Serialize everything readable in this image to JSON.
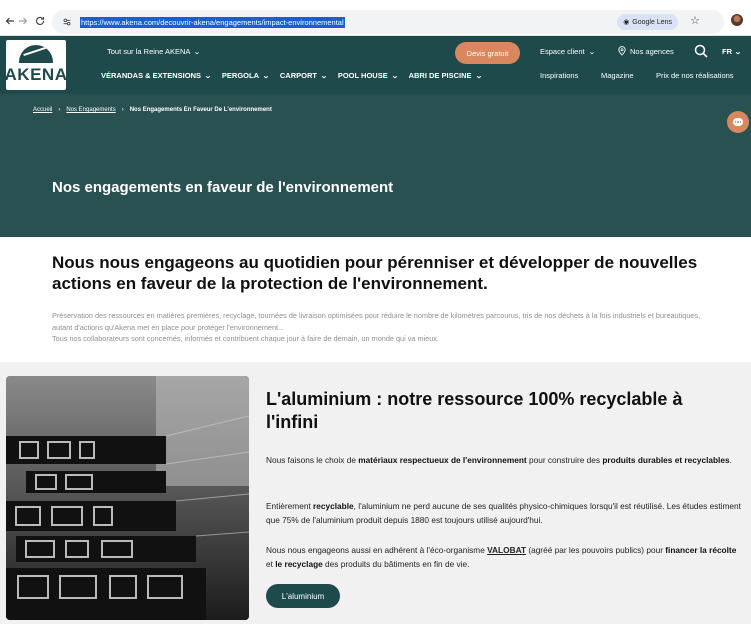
{
  "browser": {
    "url": "https://www.akena.com/decouvrir-akena/engagements/impact-environnemental",
    "lens_label": "Google Lens"
  },
  "header": {
    "logo_text": "AKENA",
    "top_link": "Tout sur la Reine AKENA",
    "devis_label": "Devis gratuit",
    "espace_label": "Espace client",
    "agences_label": "Nos agences",
    "lang_label": "FR",
    "nav": [
      {
        "label": "VÉRANDAS & EXTENSIONS"
      },
      {
        "label": "PERGOLA"
      },
      {
        "label": "CARPORT"
      },
      {
        "label": "POOL HOUSE"
      },
      {
        "label": "ABRI DE PISCINE"
      }
    ],
    "secondary_nav": [
      {
        "label": "Inspirations"
      },
      {
        "label": "Magazine"
      },
      {
        "label": "Prix de nos réalisations"
      }
    ]
  },
  "breadcrumb": {
    "home": "Accueil",
    "section": "Nos Engagements",
    "current": "Nos Engagements En Faveur De L'environnement"
  },
  "hero": {
    "title": "Nos engagements en faveur de l'environnement"
  },
  "intro": {
    "heading": "Nous nous engageons au quotidien pour pérenniser et développer de nouvelles actions en faveur de la protection de l'environnement.",
    "line1": "Préservation des ressources en matières premières, recyclage, tournées de livraison optimisées pour réduire le nombre de kilomètres parcourus, tris de nos déchets à la fois industriels et bureautiques, autant d'actions qu'Akena met en place pour protéger l'environnement...",
    "line2": "Tous nos collaborateurs sont concernés, informés et contribuent chaque jour à faire de demain, un monde qui va mieux."
  },
  "feature": {
    "title": "L'aluminium : notre ressource 100% recyclable à l'infini",
    "p1": {
      "a": "Nous faisons le choix de ",
      "b": "matériaux respectueux de l'environnement",
      "c": " pour construire des ",
      "d": "produits durables et recyclables",
      "e": "."
    },
    "p2": {
      "a": "Entièrement ",
      "b": "recyclable",
      "c": ", l'aluminium ne perd aucune de ses qualités physico-chimiques lorsqu'il est réutilisé. Les études estiment que 75% de l'aluminium produit depuis 1880 est toujours utilisé aujourd'hui."
    },
    "p3": {
      "a": "Nous nous engageons aussi en adhérent à l'éco-organisme ",
      "b": "VALOBAT",
      "c": " (agréé par les pouvoirs publics) pour ",
      "d": "financer la récolte",
      "e": " et ",
      "f": "le recyclage",
      "g": " des produits du bâtiments en fin de vie."
    },
    "button_label": "L'aluminium"
  },
  "colors": {
    "brand_dark": "#1f4a4b",
    "hero_bg": "#2a5152",
    "accent_orange": "#d8875f",
    "section_bg": "#f1f1f1"
  },
  "icons": [
    "back-arrow-icon",
    "forward-arrow-icon",
    "reload-icon",
    "site-info-icon",
    "google-lens-icon",
    "star-icon",
    "location-pin-icon",
    "search-icon",
    "chevron-down-icon",
    "chat-icon"
  ]
}
